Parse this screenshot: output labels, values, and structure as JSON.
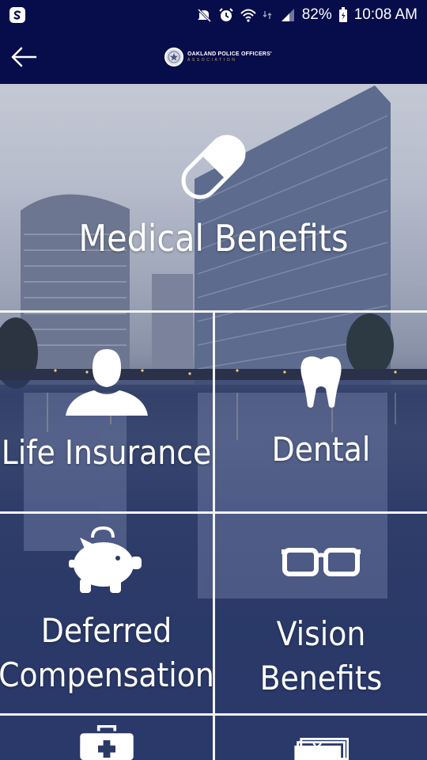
{
  "status_bar": {
    "battery": "82%",
    "time": "10:08 AM",
    "icons": [
      "app-badge-icon",
      "mute-icon",
      "alarm-icon",
      "wifi-icon",
      "no-data-icon",
      "signal-icon",
      "battery-icon"
    ]
  },
  "header": {
    "back_icon": "arrow-left-icon",
    "brand_line1": "OAKLAND POLICE OFFICERS'",
    "brand_line2": "ASSOCIATION"
  },
  "tiles": [
    {
      "label": "Medical Benefits",
      "icon": "pill-icon"
    },
    {
      "label": "Life Insurance",
      "icon": "person-icon"
    },
    {
      "label": "Dental",
      "icon": "tooth-icon"
    },
    {
      "label_line1": "Deferred",
      "label_line2": "Compensation",
      "icon": "piggy-bank-icon"
    },
    {
      "label_line1": "Vision",
      "label_line2": "Benefits",
      "icon": "glasses-icon"
    },
    {
      "label": "",
      "icon": "first-aid-kit-icon"
    },
    {
      "label": "",
      "icon": "documents-icon"
    }
  ],
  "colors": {
    "header_bg": "#070c4a",
    "divider": "#f2f3f7",
    "brand_gold": "#c9a24a"
  }
}
